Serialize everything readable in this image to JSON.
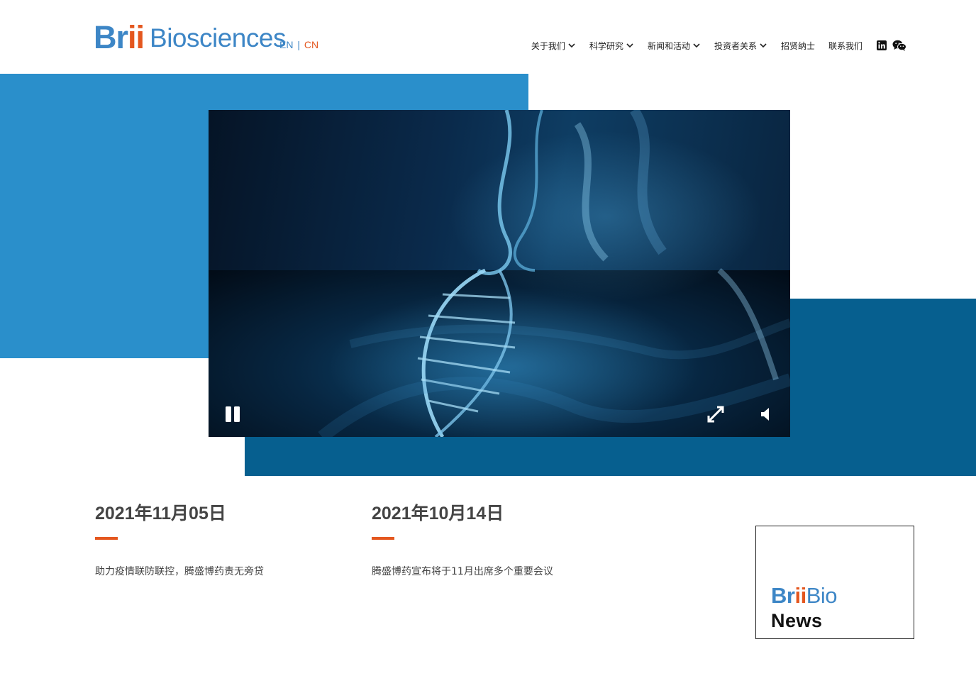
{
  "header": {
    "logo_prefix": "Br",
    "logo_ii": "ii",
    "logo_suffix": "Biosciences",
    "lang_en": "EN",
    "lang_sep": "|",
    "lang_cn": "CN"
  },
  "nav": {
    "items": [
      {
        "label": "关于我们",
        "dropdown": true
      },
      {
        "label": "科学研究",
        "dropdown": true
      },
      {
        "label": "新闻和活动",
        "dropdown": true
      },
      {
        "label": "投资者关系",
        "dropdown": true
      },
      {
        "label": "招贤纳士",
        "dropdown": false
      },
      {
        "label": "联系我们",
        "dropdown": false
      }
    ],
    "social_icons": [
      "linkedin-icon",
      "wechat-icon"
    ]
  },
  "hero": {
    "video_controls": [
      "pause-icon",
      "fullscreen-icon",
      "volume-icon"
    ]
  },
  "news": [
    {
      "date": "2021年11月05日",
      "title": "助力疫情联防联控，腾盛博药责无旁贷"
    },
    {
      "date": "2021年10月14日",
      "title": "腾盛博药宣布将于11月出席多个重要会议"
    }
  ],
  "newsbox": {
    "brand_prefix": "Br",
    "brand_ii": "ii",
    "brand_suffix": "Bio",
    "label": "News"
  },
  "colors": {
    "brand_blue": "#3d86c6",
    "accent_orange": "#e4571f",
    "hero_light_blue": "#2a8fcb",
    "hero_dark_blue": "#065f8f"
  }
}
